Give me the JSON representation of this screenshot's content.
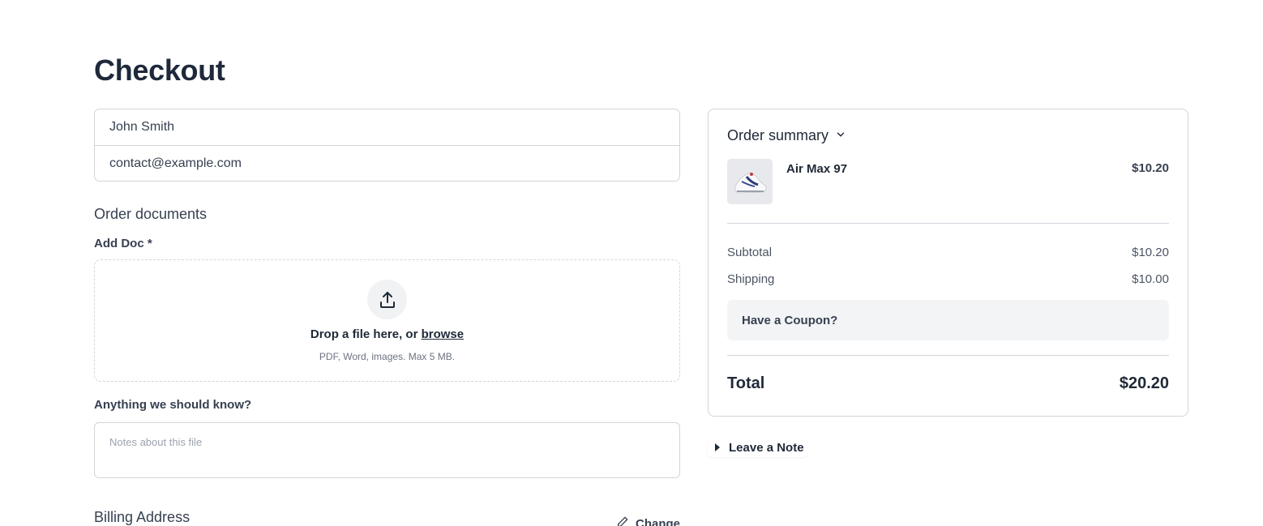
{
  "page": {
    "title": "Checkout"
  },
  "contact": {
    "name_value": "John Smith",
    "email_value": "contact@example.com"
  },
  "documents": {
    "heading": "Order documents",
    "add_doc_label": "Add Doc *",
    "drop_text": "Drop a file here, or ",
    "browse_label": "browse",
    "hint": "PDF, Word, images. Max 5 MB.",
    "upload_icon": "upload-icon"
  },
  "notes": {
    "label": "Anything we should know?",
    "placeholder": "Notes about this file"
  },
  "billing": {
    "heading": "Billing Address",
    "change_label": "Change",
    "change_icon": "pencil-icon"
  },
  "summary": {
    "title": "Order summary",
    "toggle_icon": "chevron-down-icon",
    "items": [
      {
        "name": "Air Max 97",
        "price": "$10.20",
        "thumb_icon": "sneaker-image"
      }
    ],
    "subtotal_label": "Subtotal",
    "subtotal_value": "$10.20",
    "shipping_label": "Shipping",
    "shipping_value": "$10.00",
    "coupon_label": "Have a Coupon?",
    "total_label": "Total",
    "total_value": "$20.20"
  },
  "leave_note": {
    "label": "Leave a Note",
    "icon": "caret-right-icon"
  }
}
